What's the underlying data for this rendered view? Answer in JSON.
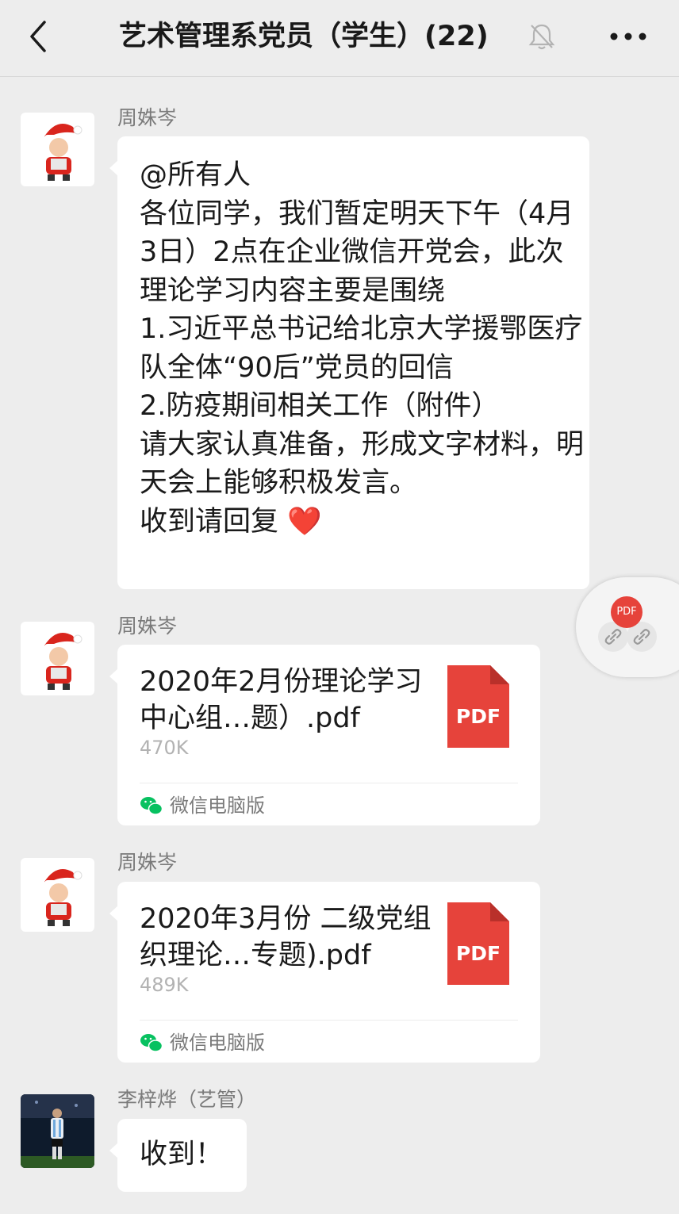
{
  "header": {
    "back_icon": "chevron-left-icon",
    "title": "艺术管理系党员（学生）(22)",
    "mute_icon": "bell-muted-icon",
    "more_icon": "more-icon"
  },
  "messages": [
    {
      "sender": "周姝岑",
      "avatar": "santa-avatar",
      "text": "@所有人\n各位同学，我们暂定明天下午（4月3日）2点在企业微信开党会，此次理论学习内容主要是围绕\n1.习近平总书记给北京大学援鄂医疗队全体“90后”党员的回信\n2.防疫期间相关工作（附件）\n请大家认真准备，形成文字材料，明天会上能够积极发言。\n收到请回复",
      "emoji": "❤️"
    },
    {
      "sender": "周姝岑",
      "avatar": "santa-avatar",
      "file_name": "2020年2月份理论学习中心组…题）.pdf",
      "file_size": "470K",
      "file_icon_label": "PDF",
      "source": "微信电脑版"
    },
    {
      "sender": "周姝岑",
      "avatar": "santa-avatar",
      "file_name": "2020年3月份 二级党组织理论…专题).pdf",
      "file_size": "489K",
      "file_icon_label": "PDF",
      "source": "微信电脑版"
    },
    {
      "sender": "李梓烨（艺管）",
      "avatar": "photo-avatar",
      "text": "收到！"
    }
  ],
  "floating_widget": {
    "badge_label": "PDF",
    "link_icons": [
      "link-icon",
      "link-icon"
    ]
  },
  "colors": {
    "background": "#ededed",
    "bubble": "#ffffff",
    "pdf_red": "#e6433b",
    "wechat_green": "#07c160"
  }
}
